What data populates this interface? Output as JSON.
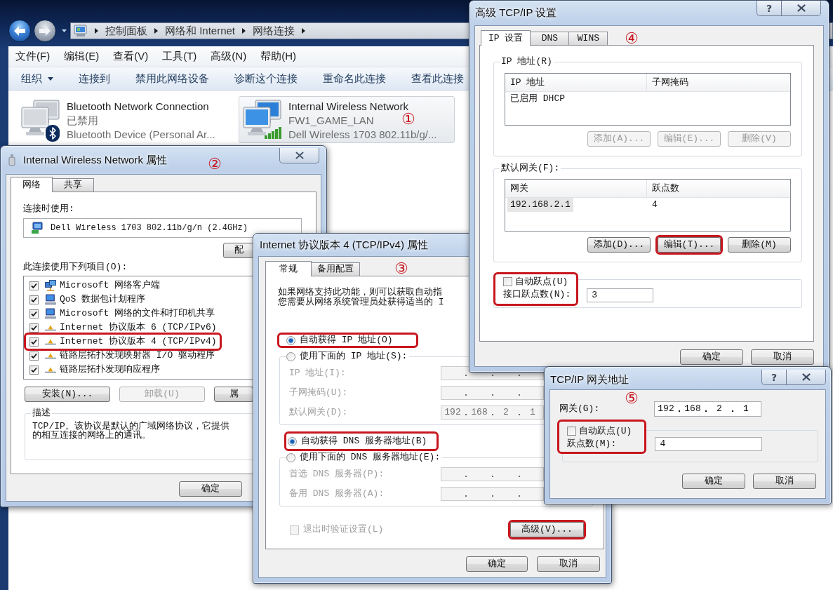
{
  "explorer": {
    "address": [
      "控制面板",
      "网络和 Internet",
      "网络连接"
    ],
    "menu": [
      "文件(F)",
      "编辑(E)",
      "查看(V)",
      "工具(T)",
      "高级(N)",
      "帮助(H)"
    ],
    "commands": [
      {
        "label": "组织",
        "dropdown": true
      },
      {
        "label": "连接到",
        "dropdown": false
      },
      {
        "label": "禁用此网络设备",
        "dropdown": false
      },
      {
        "label": "诊断这个连接",
        "dropdown": false
      },
      {
        "label": "重命名此连接",
        "dropdown": false
      },
      {
        "label": "查看此连接",
        "dropdown": false
      }
    ],
    "connections": [
      {
        "kind": "bluetooth",
        "name": "Bluetooth Network Connection",
        "status": "已禁用",
        "device": "Bluetooth Device (Personal Ar...",
        "disabled": true,
        "selected": false
      },
      {
        "kind": "wireless",
        "name": "Internal Wireless Network",
        "status": "FW1_GAME_LAN",
        "device": "Dell Wireless 1703 802.11b/g/...",
        "disabled": false,
        "selected": true,
        "annotation": "①"
      }
    ]
  },
  "properties_dialog": {
    "title": "Internal Wireless Network 属性",
    "annotation": "②",
    "tabs": [
      {
        "label": "网络",
        "selected": true
      },
      {
        "label": "共享",
        "selected": false
      }
    ],
    "connect_label": "连接时使用:",
    "adapter": "Dell Wireless 1703 802.11b/g/n (2.4GHz)",
    "configure_button": "配",
    "items_label": "此连接使用下列项目(O):",
    "items": [
      {
        "kind": "client",
        "label": "Microsoft 网络客户端",
        "checked": true,
        "highlighted": false
      },
      {
        "kind": "computer",
        "label": "QoS 数据包计划程序",
        "checked": true,
        "highlighted": false
      },
      {
        "kind": "computer",
        "label": "Microsoft 网络的文件和打印机共享",
        "checked": true,
        "highlighted": false
      },
      {
        "kind": "protocol",
        "label": "Internet 协议版本 6 (TCP/IPv6)",
        "checked": true,
        "highlighted": false
      },
      {
        "kind": "protocol",
        "label": "Internet 协议版本 4 (TCP/IPv4)",
        "checked": true,
        "highlighted": true
      },
      {
        "kind": "protocol",
        "label": "链路层拓扑发现映射器 I/O 驱动程序",
        "checked": true,
        "highlighted": false
      },
      {
        "kind": "protocol",
        "label": "链路层拓扑发现响应程序",
        "checked": true,
        "highlighted": false
      }
    ],
    "buttons": [
      {
        "label": "安装(N)...",
        "disabled": false
      },
      {
        "label": "卸载(U)",
        "disabled": true
      },
      {
        "label": "属",
        "disabled": false
      }
    ],
    "description_label": "描述",
    "description": [
      "TCP/IP。该协议是默认的广域网络协议，它提供",
      "的相互连接的网络上的通讯。"
    ],
    "ok_button": "确定"
  },
  "ipv4_dialog": {
    "title": "Internet 协议版本 4 (TCP/IPv4) 属性",
    "annotation": "③",
    "tabs": [
      {
        "label": "常规",
        "selected": true
      },
      {
        "label": "备用配置",
        "selected": false
      }
    ],
    "intro": [
      "如果网络支持此功能，则可以获取自动指",
      "您需要从网络系统管理员处获得适当的 I"
    ],
    "ip_options": [
      {
        "label": "自动获得 IP 地址(O)",
        "selected": true,
        "highlighted": true
      },
      {
        "label": "使用下面的 IP 地址(S):",
        "selected": false,
        "highlighted": false
      }
    ],
    "ip_fields": [
      {
        "label": "IP 地址(I):",
        "disabled": true
      },
      {
        "label": "子网掩码(U):",
        "disabled": true
      },
      {
        "label": "默认网关(D):",
        "octets": [
          "192",
          "168",
          "2",
          "1"
        ],
        "disabled": true
      }
    ],
    "dns_options": [
      {
        "label": "自动获得 DNS 服务器地址(B)",
        "selected": true,
        "highlighted": true
      },
      {
        "label": "使用下面的 DNS 服务器地址(E):",
        "selected": false,
        "highlighted": false
      }
    ],
    "dns_fields": [
      {
        "label": "首选 DNS 服务器(P):",
        "disabled": true
      },
      {
        "label": "备用 DNS 服务器(A):",
        "disabled": true
      }
    ],
    "validate": {
      "label": "退出时验证设置(L)",
      "checked": false,
      "disabled": true
    },
    "advanced_button": {
      "label": "高级(V)...",
      "highlighted": true
    },
    "ok_button": "确定",
    "cancel_button": "取消"
  },
  "advanced_dialog": {
    "title": "高级 TCP/IP 设置",
    "help_button": "?",
    "annotation": "④",
    "tabs": [
      {
        "label": "IP 设置",
        "selected": true
      },
      {
        "label": "DNS",
        "selected": false
      },
      {
        "label": "WINS",
        "selected": false
      }
    ],
    "ip_group": {
      "label": "IP 地址(R)",
      "columns": [
        "IP 地址",
        "子网掩码"
      ],
      "rows": [
        {
          "cells": [
            "已启用 DHCP"
          ],
          "selected": false
        }
      ],
      "buttons": [
        {
          "label": "添加(A)...",
          "disabled": true,
          "highlighted": false
        },
        {
          "label": "编辑(E)...",
          "disabled": true,
          "highlighted": false
        },
        {
          "label": "删除(V)",
          "disabled": true,
          "highlighted": false
        }
      ]
    },
    "gateway_group": {
      "label": "默认网关(F):",
      "columns": [
        "网关",
        "跃点数"
      ],
      "rows": [
        {
          "cells": [
            "192.168.2.1",
            "4"
          ],
          "selected": true
        }
      ],
      "buttons": [
        {
          "label": "添加(D)...",
          "disabled": false,
          "highlighted": false
        },
        {
          "label": "编辑(T)...",
          "disabled": false,
          "highlighted": true
        },
        {
          "label": "删除(M)",
          "disabled": false,
          "highlighted": false
        }
      ]
    },
    "auto_metric": {
      "label": "自动跃点(U)",
      "checked": false
    },
    "metric_label": "接口跃点数(N):",
    "metric": "3",
    "metric_highlighted": true,
    "ok_button": "确定",
    "cancel_button": "取消"
  },
  "gateway_dialog": {
    "title": "TCP/IP 网关地址",
    "help_button": "?",
    "annotation": "⑤",
    "gateway_label": "网关(G):",
    "gateway": [
      "192",
      "168",
      "2",
      "1"
    ],
    "auto_metric": {
      "label": "自动跃点(U)",
      "checked": false
    },
    "metric_label": "跃点数(M):",
    "metric": "4",
    "metric_highlighted": true,
    "ok_button": "确定",
    "cancel_button": "取消"
  }
}
